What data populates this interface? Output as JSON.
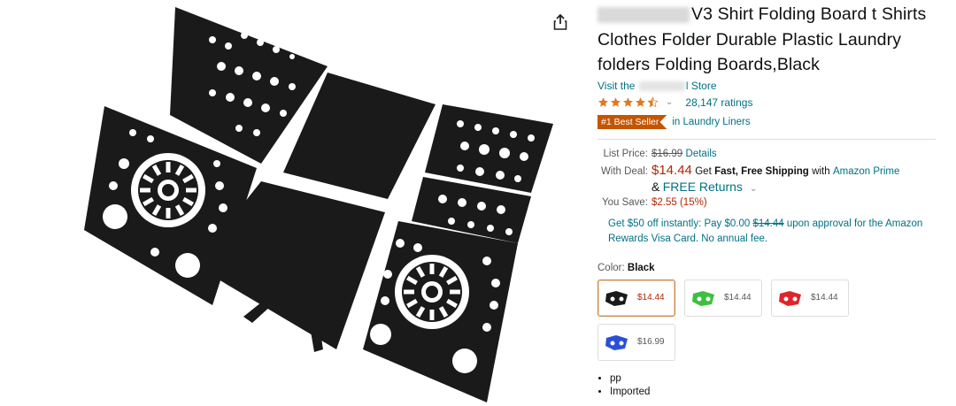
{
  "product": {
    "title_visible": "V3 Shirt Folding Board t Shirts Clothes Folder Durable Plastic Laundry folders Folding Boards,Black",
    "store_prefix": "Visit the",
    "store_suffix": "l Store",
    "rating_stars": 4.5,
    "ratings_count": "28,147 ratings",
    "best_seller_badge": "#1 Best Seller",
    "best_seller_category": "in Laundry Liners"
  },
  "pricing": {
    "list_price_label": "List Price:",
    "list_price": "$16.99",
    "details_link": "Details",
    "with_deal_label": "With Deal:",
    "deal_price": "$14.44",
    "shipping_pre": "Get",
    "shipping_bold": "Fast, Free Shipping",
    "shipping_with": "with",
    "prime_link": "Amazon Prime",
    "returns_amp": "&",
    "returns_link": "FREE Returns",
    "you_save_label": "You Save:",
    "you_save": "$2.55 (15%)"
  },
  "promo": {
    "text_before": "Get $50 off instantly: Pay $0.00",
    "strike_price": "$14.44",
    "text_after": "upon approval for the Amazon Rewards Visa Card. No annual fee."
  },
  "color": {
    "label": "Color:",
    "selected": "Black",
    "options": [
      {
        "price": "$14.44",
        "color": "#1a1a1a"
      },
      {
        "price": "$14.44",
        "color": "#3fbf3f"
      },
      {
        "price": "$14.44",
        "color": "#e0242c"
      },
      {
        "price": "$16.99",
        "color": "#2b4fd6"
      }
    ]
  },
  "bullets": [
    "pp",
    "Imported"
  ],
  "colors": {
    "link": "#007185",
    "price": "#b12704",
    "badge": "#c45500",
    "star": "#de7921"
  }
}
